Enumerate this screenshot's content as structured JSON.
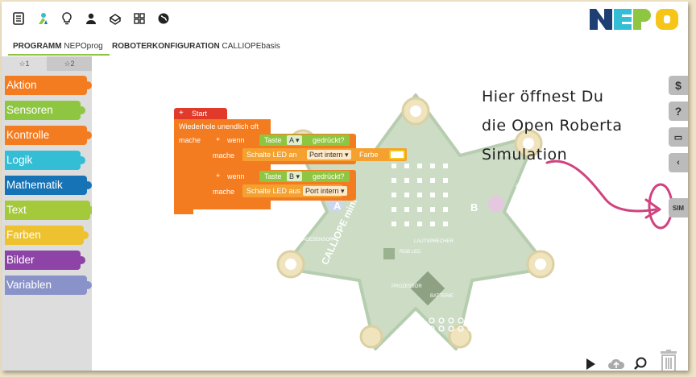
{
  "tabs": {
    "program_label": "PROGRAMM",
    "program_name": "NEPOprog",
    "robot_label": "ROBOTERKONFIGURATION",
    "robot_name": "CALLIOPEbasis"
  },
  "toolbox": {
    "levels": [
      "1",
      "2"
    ],
    "categories": [
      {
        "label": "Aktion",
        "color": "#f47c20"
      },
      {
        "label": "Sensoren",
        "color": "#8fc641"
      },
      {
        "label": "Kontrolle",
        "color": "#f47c20"
      },
      {
        "label": "Logik",
        "color": "#33bed6"
      },
      {
        "label": "Mathematik",
        "color": "#1573b6"
      },
      {
        "label": "Text",
        "color": "#a4c93a"
      },
      {
        "label": "Farben",
        "color": "#edc22e"
      },
      {
        "label": "Bilder",
        "color": "#8e44a7"
      },
      {
        "label": "Variablen",
        "color": "#8a93c9"
      }
    ]
  },
  "program": {
    "start_label": "Start",
    "loop_label": "Wiederhole unendlich oft",
    "do_label": "mache",
    "if1": {
      "if_label": "wenn",
      "sensor_label": "Taste",
      "key": "A",
      "pressed_label": "gedrückt?",
      "do_label": "mache",
      "action_label": "Schalte LED an",
      "port": "Port intern",
      "color_label": "Farbe"
    },
    "if2": {
      "if_label": "wenn",
      "sensor_label": "Taste",
      "key": "B",
      "pressed_label": "gedrückt?",
      "do_label": "mache",
      "action_label": "Schalte LED aus",
      "port": "Port intern"
    }
  },
  "board_labels": {
    "reset": "RESET",
    "a1": "A1",
    "lagesensor": "LAGESENSOR",
    "lautsprecher": "LAUTSPRECHER",
    "rgb_led": "RGB LED",
    "prozessor": "PROZESSOR",
    "batterie": "BATTERIE",
    "button_a": "A",
    "button_b": "B",
    "brand": "CALLIOPE mini"
  },
  "annotation": {
    "line1": "Hier öffnest Du",
    "line2": "die Open Roberta",
    "line3": "Simulation"
  },
  "side_buttons": {
    "code": "$",
    "help": "?",
    "sim": "SIM"
  },
  "colors": {
    "accent_green": "#8fc641",
    "logo_blue": "#1d3f73",
    "logo_green": "#8fc641",
    "logo_yellow": "#f5c518",
    "logo_teal": "#33bed6",
    "highlight": "#d0437f",
    "board": "#ccdcc5"
  }
}
